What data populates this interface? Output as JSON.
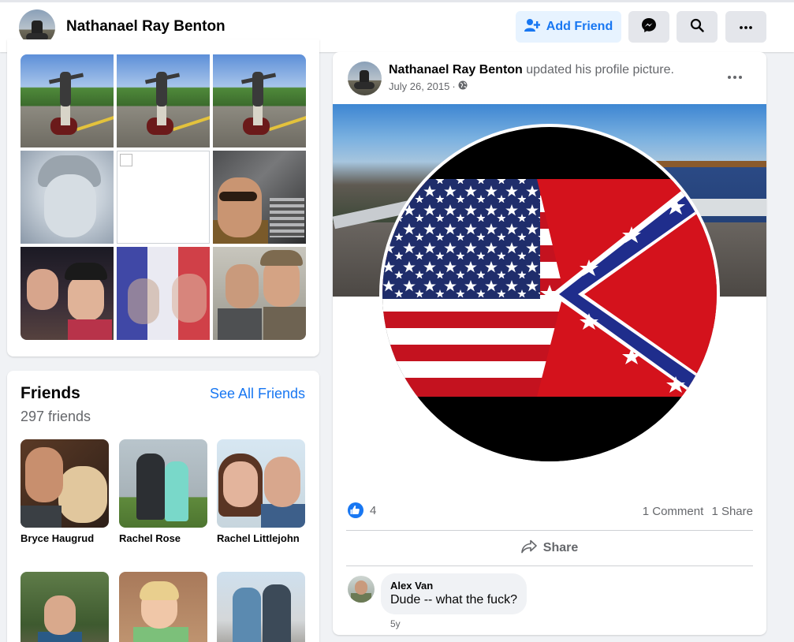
{
  "header": {
    "name": "Nathanael Ray Benton",
    "add_friend_label": "Add Friend",
    "icons": [
      "add-friend-icon",
      "messenger-icon",
      "search-icon",
      "more-icon"
    ]
  },
  "friends": {
    "title": "Friends",
    "see_all": "See All Friends",
    "count": "297 friends",
    "items": [
      {
        "name": "Bryce Haugrud"
      },
      {
        "name": "Rachel Rose"
      },
      {
        "name": "Rachel Littlejohn"
      },
      {
        "name": ""
      },
      {
        "name": ""
      },
      {
        "name": ""
      }
    ]
  },
  "post": {
    "author": "Nathanael Ray Benton",
    "action": " updated his profile picture.",
    "date": "July 26, 2015",
    "separator": "·",
    "privacy_icon": "globe-icon",
    "likes": "4",
    "comments_count": "1 Comment",
    "shares_count": "1 Share",
    "share_label": "Share",
    "comment": {
      "author": "Alex Van",
      "text": "Dude -- what the fuck?",
      "age": "5y"
    }
  },
  "colors": {
    "accent": "#1877f2",
    "accent_light": "#e7f3ff",
    "button_gray": "#e4e6eb",
    "page_bg": "#f0f2f5",
    "secondary_text": "#65676b"
  }
}
